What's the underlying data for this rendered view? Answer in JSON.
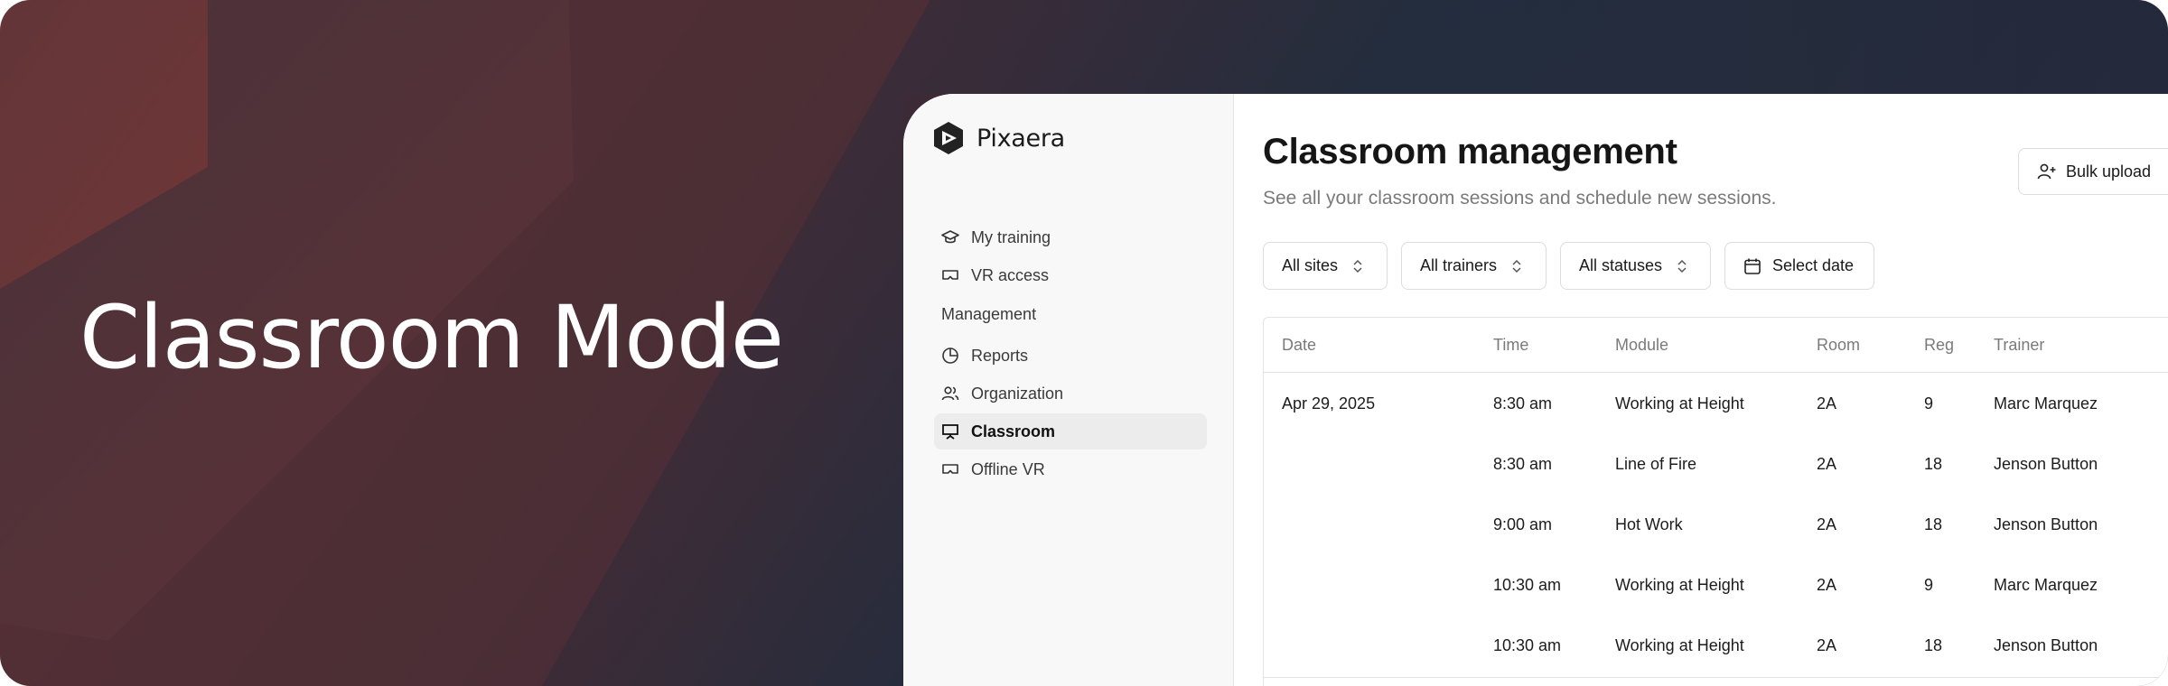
{
  "hero": {
    "title": "Classroom Mode"
  },
  "app": {
    "brand": "Pixaera",
    "sidebar": {
      "primary_items": [
        {
          "label": "My training",
          "icon": "graduation-cap-icon"
        },
        {
          "label": "VR access",
          "icon": "vr-headset-icon"
        }
      ],
      "group_label": "Management",
      "management_items": [
        {
          "label": "Reports",
          "icon": "pie-chart-icon"
        },
        {
          "label": "Organization",
          "icon": "users-icon"
        },
        {
          "label": "Classroom",
          "icon": "presentation-icon",
          "active": true
        },
        {
          "label": "Offline VR",
          "icon": "vr-headset-icon"
        }
      ]
    },
    "header": {
      "title": "Classroom management",
      "subtitle": "See all your classroom sessions and schedule new sessions.",
      "bulk_upload_label": "Bulk upload"
    },
    "filters": {
      "sites": "All sites",
      "trainers": "All trainers",
      "statuses": "All statuses",
      "date": "Select date"
    },
    "table": {
      "columns": [
        "Date",
        "Time",
        "Module",
        "Room",
        "Reg",
        "Trainer"
      ],
      "rows": [
        {
          "date": "Apr 29, 2025",
          "time": "8:30 am",
          "module": "Working at Height",
          "room": "2A",
          "reg": "9",
          "trainer": "Marc Marquez"
        },
        {
          "date": "",
          "time": "8:30 am",
          "module": "Line of Fire",
          "room": "2A",
          "reg": "18",
          "trainer": "Jenson Button"
        },
        {
          "date": "",
          "time": "9:00 am",
          "module": "Hot Work",
          "room": "2A",
          "reg": "18",
          "trainer": "Jenson Button"
        },
        {
          "date": "",
          "time": "10:30 am",
          "module": "Working at Height",
          "room": "2A",
          "reg": "9",
          "trainer": "Marc Marquez"
        },
        {
          "date": "",
          "time": "10:30 am",
          "module": "Working at Height",
          "room": "2A",
          "reg": "18",
          "trainer": "Jenson Button"
        }
      ]
    }
  },
  "colors": {
    "banner_dark": "#222c3c",
    "banner_warm": "#5a2f33",
    "text_primary": "#161616",
    "text_muted": "#7a7a7a",
    "sidebar_bg": "#f8f8f8",
    "active_bg": "#ececec"
  }
}
